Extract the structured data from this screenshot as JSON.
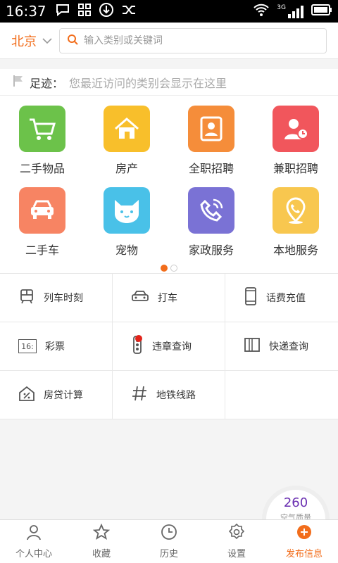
{
  "status": {
    "time": "16:37",
    "network": "3G"
  },
  "header": {
    "city": "北京",
    "search_placeholder": "输入类别或关键词"
  },
  "footprint": {
    "label": "足迹：",
    "hint": "您最近访问的类别会显示在这里"
  },
  "categories": [
    {
      "label": "二手物品",
      "icon": "shopping-cart-icon",
      "color": "#6cc24a"
    },
    {
      "label": "房产",
      "icon": "house-icon",
      "color": "#f8bf2b"
    },
    {
      "label": "全职招聘",
      "icon": "id-card-icon",
      "color": "#f58d3a"
    },
    {
      "label": "兼职招聘",
      "icon": "person-clock-icon",
      "color": "#f1565c"
    },
    {
      "label": "二手车",
      "icon": "car-icon",
      "color": "#f78463"
    },
    {
      "label": "宠物",
      "icon": "cat-icon",
      "color": "#49c1e8"
    },
    {
      "label": "家政服务",
      "icon": "phone-icon",
      "color": "#7a72d5"
    },
    {
      "label": "本地服务",
      "icon": "location-phone-icon",
      "color": "#f8c74f"
    }
  ],
  "tools": [
    {
      "label": "列车时刻",
      "icon": "train-icon"
    },
    {
      "label": "打车",
      "icon": "taxi-icon"
    },
    {
      "label": "话费充值",
      "icon": "mobile-icon"
    },
    {
      "label": "彩票",
      "icon": "lottery-icon",
      "badge_text": "16:"
    },
    {
      "label": "违章查询",
      "icon": "traffic-light-icon"
    },
    {
      "label": "快递查询",
      "icon": "package-icon"
    },
    {
      "label": "房贷计算",
      "icon": "house-percent-icon"
    },
    {
      "label": "地铁线路",
      "icon": "hash-icon"
    }
  ],
  "aqi": {
    "value": "260",
    "label": "空气质量"
  },
  "tabbar": [
    {
      "label": "个人中心",
      "icon": "person-icon"
    },
    {
      "label": "收藏",
      "icon": "star-icon"
    },
    {
      "label": "历史",
      "icon": "clock-icon"
    },
    {
      "label": "设置",
      "icon": "gear-icon"
    },
    {
      "label": "发布信息",
      "icon": "publish-icon"
    }
  ],
  "colors": {
    "accent": "#f26d1b",
    "red_badge": "#e2231a"
  }
}
